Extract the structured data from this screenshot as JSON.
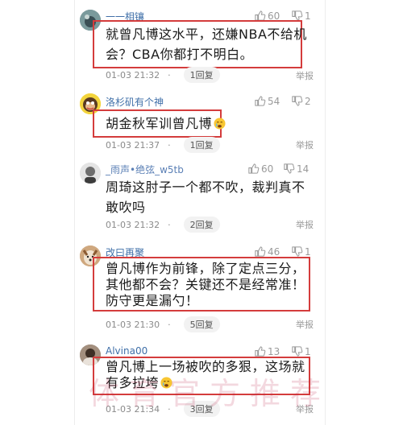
{
  "comments": [
    {
      "username": "一一相镶",
      "likes": "60",
      "dislikes": "1",
      "text": "就曾凡博这水平，还嫌NBA不给机会？CBA你都打不明白。",
      "time": "01-03 21:32",
      "reply": "1回复",
      "report": "举报"
    },
    {
      "username": "洛杉矶有个神",
      "likes": "54",
      "dislikes": "2",
      "text": "胡金秋军训曾凡博",
      "time": "01-03 21:37",
      "reply": "1回复",
      "report": "举报"
    },
    {
      "username": "_雨声•绝弦_w5tb",
      "likes": "60",
      "dislikes": "14",
      "text": "周琦这肘子一个都不吹，裁判真不敢吹吗",
      "time": "01-03 21:32",
      "reply": "2回复",
      "report": "举报"
    },
    {
      "username": "改曰再聚",
      "likes": "46",
      "dislikes": "1",
      "text": "曾凡博作为前锋，除了定点三分，其他都不会？关键还不是经常准！防守更是漏勺！",
      "time": "01-03 21:30",
      "reply": "5回复",
      "report": "举报"
    },
    {
      "username": "Alvina00",
      "likes": "13",
      "dislikes": "1",
      "text": "曾凡博上一场被吹的多狠，这场就有多拉垮",
      "time": "01-03 21:34",
      "reply": "3回复",
      "report": "举报"
    }
  ],
  "watermark": "体育官方推荐",
  "colors": {
    "highlight_border": "#d43c3c",
    "username": "#3f6fa8"
  }
}
